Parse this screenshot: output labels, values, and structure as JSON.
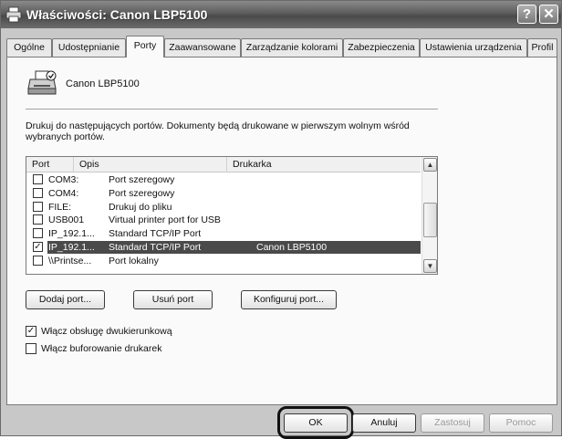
{
  "window": {
    "title": "Właściwości: Canon LBP5100"
  },
  "titlebar": {
    "help_label": "?",
    "close_label": "✕"
  },
  "tabs": [
    {
      "label": "Ogólne"
    },
    {
      "label": "Udostępnianie"
    },
    {
      "label": "Porty",
      "active": true
    },
    {
      "label": "Zaawansowane"
    },
    {
      "label": "Zarządzanie kolorami"
    },
    {
      "label": "Zabezpieczenia"
    },
    {
      "label": "Ustawienia urządzenia"
    },
    {
      "label": "Profil"
    }
  ],
  "printer": {
    "name": "Canon LBP5100",
    "icon": "printer-icon"
  },
  "description": "Drukuj do następujących portów. Dokumenty będą drukowane w pierwszym wolnym wśród wybranych portów.",
  "description_mnemonic": "D",
  "ports_table": {
    "columns": [
      "Port",
      "Opis",
      "Drukarka"
    ],
    "rows": [
      {
        "checked": false,
        "port": "COM3:",
        "desc": "Port szeregowy",
        "printer": "",
        "selected": false
      },
      {
        "checked": false,
        "port": "COM4:",
        "desc": "Port szeregowy",
        "printer": "",
        "selected": false
      },
      {
        "checked": false,
        "port": "FILE:",
        "desc": "Drukuj do pliku",
        "printer": "",
        "selected": false
      },
      {
        "checked": false,
        "port": "USB001",
        "desc": "Virtual printer port for USB",
        "printer": "",
        "selected": false
      },
      {
        "checked": false,
        "port": "IP_192.1...",
        "desc": "Standard TCP/IP Port",
        "printer": "",
        "selected": false
      },
      {
        "checked": true,
        "port": "IP_192.1...",
        "desc": "Standard TCP/IP Port",
        "printer": "Canon LBP5100",
        "selected": true
      },
      {
        "checked": false,
        "port": "\\\\Printse...",
        "desc": "Port lokalny",
        "printer": "",
        "selected": false
      }
    ]
  },
  "port_buttons": {
    "add": "Dodaj port...",
    "delete": "Usuń port",
    "configure": "Konfiguruj port..."
  },
  "options": {
    "bidirectional": {
      "label": "Włącz obsługę dwukierunkową",
      "checked": true
    },
    "pooling": {
      "label": "Włącz buforowanie drukarek",
      "checked": false
    }
  },
  "footer": {
    "ok": "OK",
    "cancel": "Anuluj",
    "apply": "Zastosuj",
    "help": "Pomoc"
  }
}
